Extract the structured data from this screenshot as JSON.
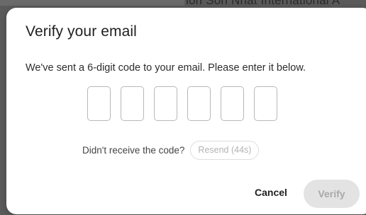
{
  "background": {
    "peek_text": "ion Son Nhat International A"
  },
  "dialog": {
    "title": "Verify your email",
    "subtitle": "We've sent a 6-digit code to your email. Please enter it below.",
    "code": {
      "digits": [
        "",
        "",
        "",
        "",
        "",
        ""
      ]
    },
    "resend_prompt": "Didn't receive the code?",
    "resend_label": "Resend (44s)",
    "cancel_label": "Cancel",
    "verify_label": "Verify"
  },
  "colors": {
    "verify_disabled_bg": "#e3e3e3",
    "verify_disabled_text": "#a9a9a9",
    "resend_disabled_text": "#b3b3b3"
  }
}
